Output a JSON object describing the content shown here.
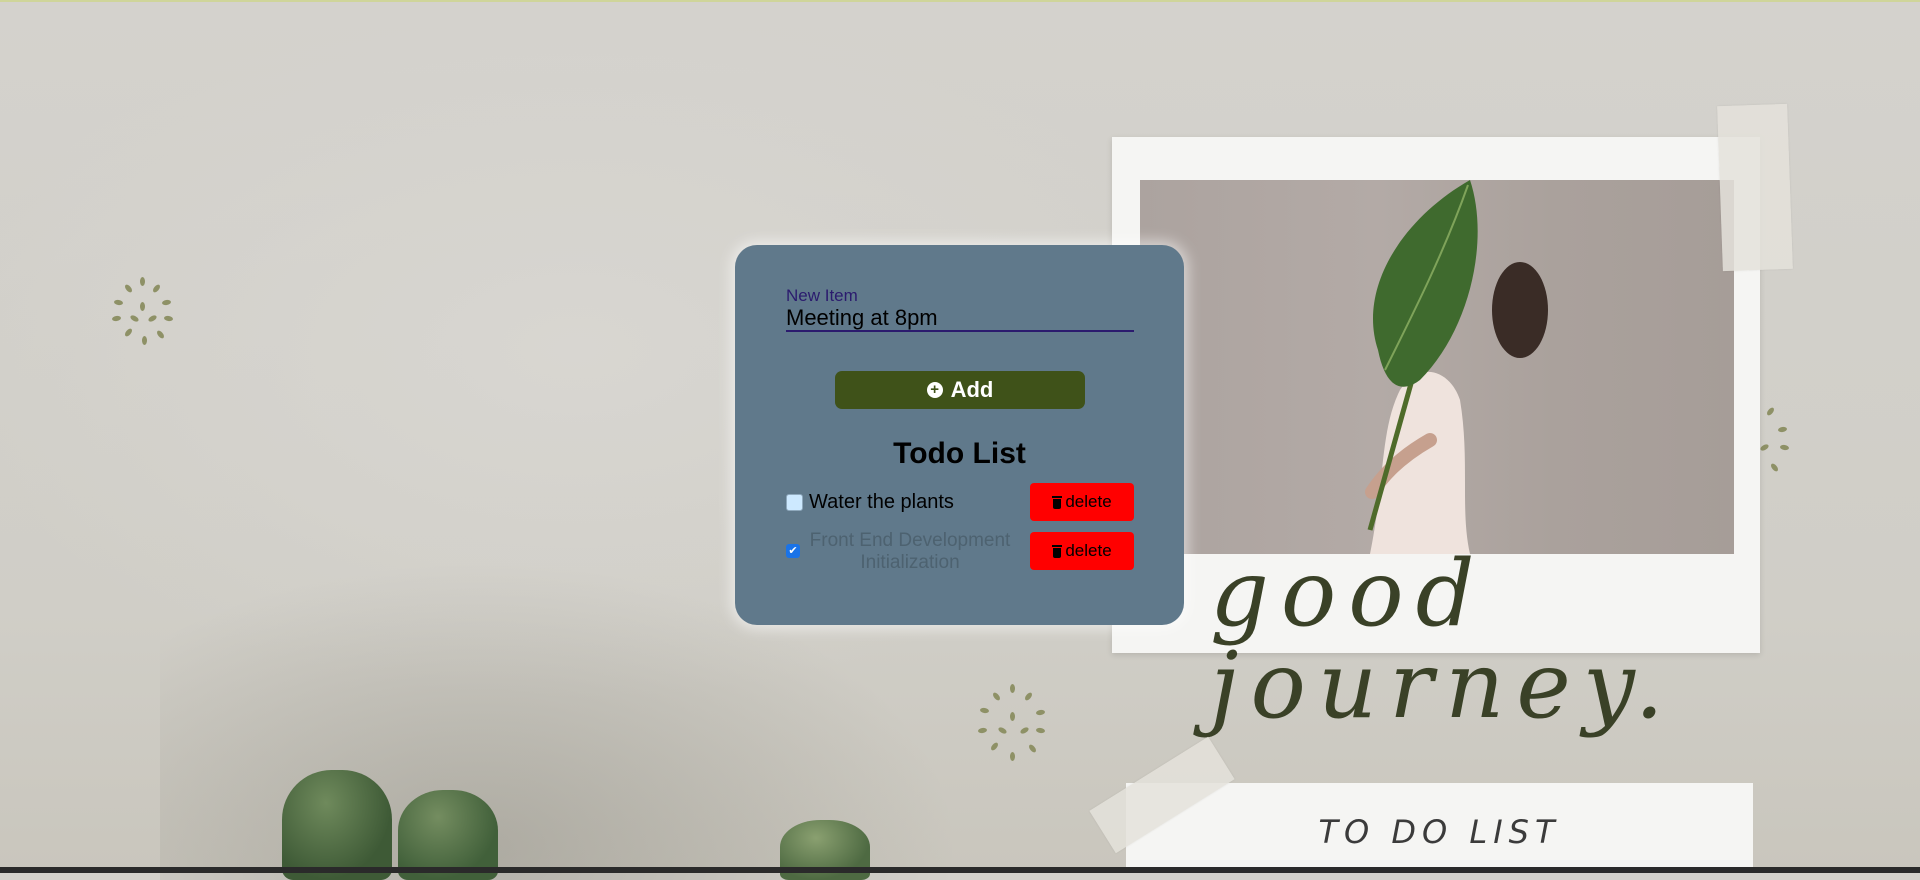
{
  "form": {
    "label": "New Item",
    "value": "Meeting at 8pm"
  },
  "add_button": {
    "label": "Add",
    "icon": "plus-circle-icon"
  },
  "list": {
    "title": "Todo List",
    "items": [
      {
        "text": "Water the plants",
        "checked": false,
        "delete_label": "delete"
      },
      {
        "text": "Front End Development Initialization",
        "checked": true,
        "delete_label": "delete"
      }
    ]
  },
  "decor": {
    "script_text": "good journey.",
    "card_title": "TO DO LIST"
  },
  "colors": {
    "panel": "#60798b",
    "add_button": "#3f5219",
    "delete_button": "#ff0000",
    "field_label": "#2b1b6e"
  }
}
